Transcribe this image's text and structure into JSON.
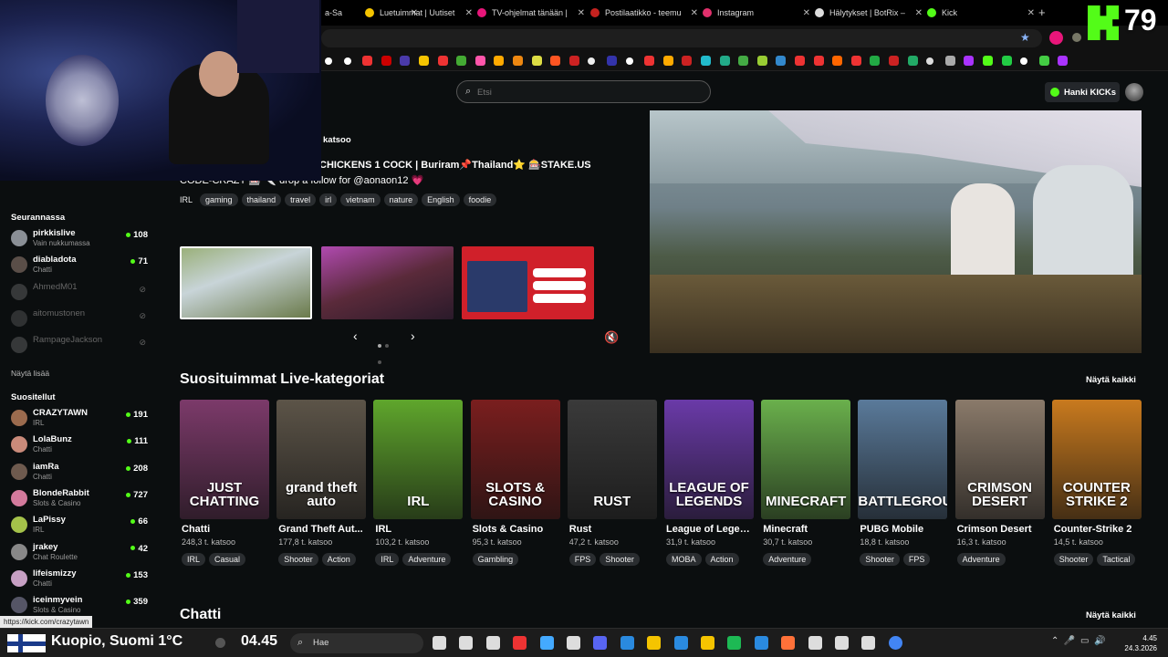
{
  "browser": {
    "tabs": [
      {
        "label": "a-Sa",
        "color": "#888"
      },
      {
        "label": "Luetuimmat | Uutiset",
        "color": "#f5c400"
      },
      {
        "label": "TV-ohjelmat tänään |",
        "color": "#e8167a"
      },
      {
        "label": "Postilaatikko - teemu",
        "color": "#c5221f"
      },
      {
        "label": "Instagram",
        "color": "#e1306c"
      },
      {
        "label": "Hälytykset | BotRix –",
        "color": "#ddd"
      },
      {
        "label": "Kick",
        "color": "#53fc18"
      }
    ],
    "new_tab": "+",
    "kick_overlay_number": "79"
  },
  "header": {
    "search_placeholder": "Etsi",
    "get_kicks": "Hanki KICKs"
  },
  "sidebar": {
    "following_title": "Seurannassa",
    "following": [
      {
        "name": "pirkkislive",
        "sub": "Vain nukkumassa",
        "count": "108",
        "live": true,
        "color": "#8a8f96"
      },
      {
        "name": "diabladota",
        "sub": "Chatti",
        "count": "71",
        "live": true,
        "color": "#5a4e48"
      },
      {
        "name": "AhmedM01",
        "sub": "",
        "count": "",
        "live": false,
        "color": "#777"
      },
      {
        "name": "aitomustonen",
        "sub": "",
        "count": "",
        "live": false,
        "color": "#666"
      },
      {
        "name": "RampageJackson",
        "sub": "",
        "count": "",
        "live": false,
        "color": "#777"
      }
    ],
    "show_more": "Näytä lisää",
    "recommended_title": "Suositellut",
    "recommended": [
      {
        "name": "CRAZYTAWN",
        "sub": "IRL",
        "count": "191",
        "color": "#9b6b4e"
      },
      {
        "name": "LolaBunz",
        "sub": "Chatti",
        "count": "111",
        "color": "#c98a7a"
      },
      {
        "name": "iamRa",
        "sub": "Chatti",
        "count": "208",
        "color": "#6e5a4e"
      },
      {
        "name": "BlondeRabbit",
        "sub": "Slots & Casino",
        "count": "727",
        "color": "#d37a9c"
      },
      {
        "name": "LaPissy",
        "sub": "IRL",
        "count": "66",
        "color": "#a4c24a"
      },
      {
        "name": "jrakey",
        "sub": "Chat Roulette",
        "count": "42",
        "color": "#888"
      },
      {
        "name": "lifeismizzy",
        "sub": "Chatti",
        "count": "153",
        "color": "#c7a0c4"
      },
      {
        "name": "iceinmyvein",
        "sub": "Slots & Casino",
        "count": "359",
        "color": "#556"
      }
    ]
  },
  "featured": {
    "viewers_suffix": "katsoo",
    "title": "CHICKENS 1 COCK | Buriram📌Thailand⭐ 🎰STAKE.US",
    "subtitle": "CODE-CRAZY 🎰 🔪 drop a follow for @aonaon12 💗",
    "tags": [
      "IRL",
      "gaming",
      "thailand",
      "travel",
      "irl",
      "vietnam",
      "nature",
      "English",
      "foodie"
    ]
  },
  "popular": {
    "title": "Suosituimmat Live-kategoriat",
    "show_all": "Näytä kaikki",
    "categories": [
      {
        "name": "Chatti",
        "viewers": "248,3 t. katsoo",
        "tags": [
          "IRL",
          "Casual"
        ],
        "art": "JUST CHATTING",
        "bg": "#7c3a6a"
      },
      {
        "name": "Grand Theft Aut...",
        "viewers": "177,8 t. katsoo",
        "tags": [
          "Shooter",
          "Action"
        ],
        "art": "grand theft auto",
        "bg": "#5c5448"
      },
      {
        "name": "IRL",
        "viewers": "103,2 t. katsoo",
        "tags": [
          "IRL",
          "Adventure"
        ],
        "art": "IRL",
        "bg": "#5fa62c"
      },
      {
        "name": "Slots & Casino",
        "viewers": "95,3 t. katsoo",
        "tags": [
          "Gambling"
        ],
        "art": "SLOTS & CASINO",
        "bg": "#7a1e1e"
      },
      {
        "name": "Rust",
        "viewers": "47,2 t. katsoo",
        "tags": [
          "FPS",
          "Shooter"
        ],
        "art": "RUST",
        "bg": "#3a3a3a"
      },
      {
        "name": "League of Legen...",
        "viewers": "31,9 t. katsoo",
        "tags": [
          "MOBA",
          "Action"
        ],
        "art": "LEAGUE OF LEGENDS",
        "bg": "#6a3aa8"
      },
      {
        "name": "Minecraft",
        "viewers": "30,7 t. katsoo",
        "tags": [
          "Adventure"
        ],
        "art": "MINECRAFT",
        "bg": "#6ab04c"
      },
      {
        "name": "PUBG Mobile",
        "viewers": "18,8 t. katsoo",
        "tags": [
          "Shooter",
          "FPS"
        ],
        "art": "BATTLEGROUNDS",
        "bg": "#5a7a9a"
      },
      {
        "name": "Crimson Desert",
        "viewers": "16,3 t. katsoo",
        "tags": [
          "Adventure"
        ],
        "art": "CRIMSON DESERT",
        "bg": "#8a7a6a"
      },
      {
        "name": "Counter-Strike 2",
        "viewers": "14,5 t. katsoo",
        "tags": [
          "Shooter",
          "Tactical"
        ],
        "art": "COUNTER STRIKE 2",
        "bg": "#c97a1e"
      }
    ]
  },
  "chat_section": {
    "title": "Chatti",
    "show_all": "Näytä kaikki"
  },
  "status_link": "https://kick.com/crazytawn",
  "taskbar": {
    "weather": "Kuopio, Suomi 1°C",
    "big_clock": "04.45",
    "search": "Hae",
    "time": "4.45",
    "date": "24.3.2026"
  }
}
